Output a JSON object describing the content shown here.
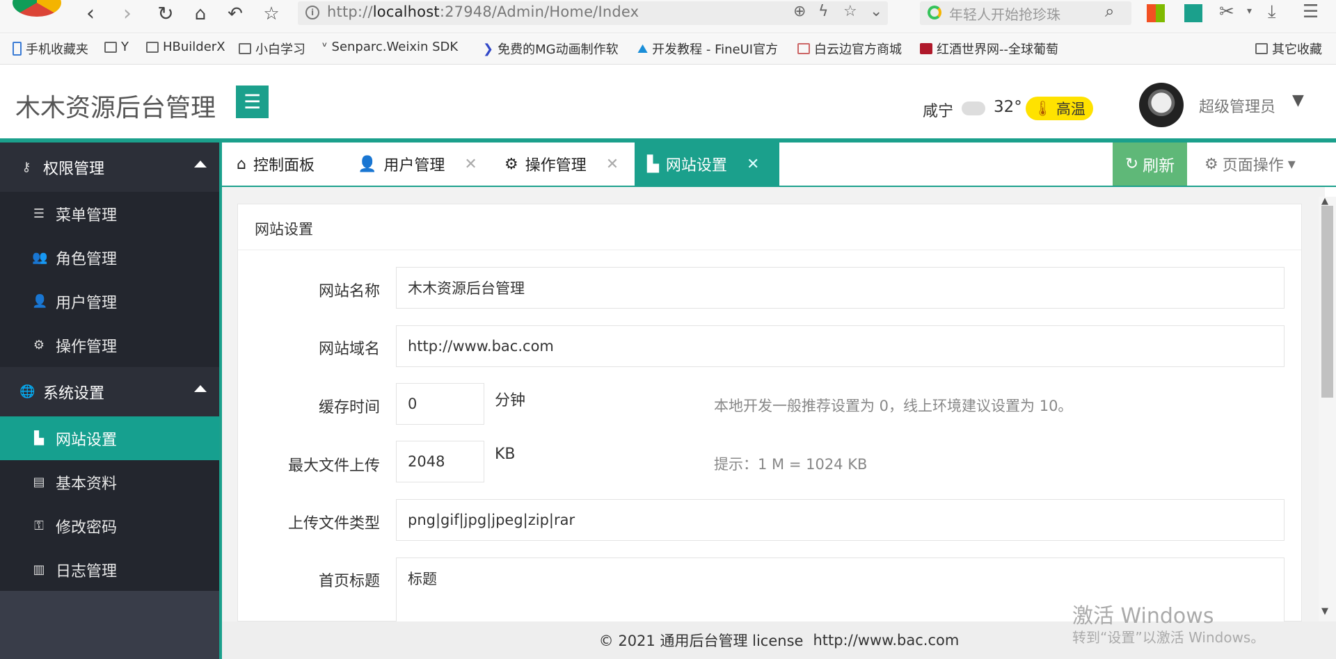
{
  "browser": {
    "url_prefix": "http://",
    "url_host": "localhost",
    "url_rest": ":27948/Admin/Home/Index",
    "search_placeholder": "年轻人开始抢珍珠"
  },
  "bookmarks": [
    "手机收藏夹",
    "Y",
    "HBuilderX",
    "小白学习",
    "Senparc.Weixin SDK",
    "免费的MG动画制作软",
    "开发教程 - FineUI官方",
    "白云边官方商城",
    "红酒世界网--全球葡萄",
    "其它收藏"
  ],
  "header": {
    "title": "木木资源后台管理",
    "city": "咸宁",
    "temperature": "32°",
    "weather_badge": "高温",
    "username": "超级管理员"
  },
  "sidebar": {
    "groups": [
      {
        "label": "权限管理",
        "items": [
          "菜单管理",
          "角色管理",
          "用户管理",
          "操作管理"
        ]
      },
      {
        "label": "系统设置",
        "items": [
          "网站设置",
          "基本资料",
          "修改密码",
          "日志管理"
        ]
      }
    ],
    "active_item": "网站设置"
  },
  "tabs": [
    {
      "label": "控制面板",
      "closable": false,
      "active": false
    },
    {
      "label": "用户管理",
      "closable": true,
      "active": false
    },
    {
      "label": "操作管理",
      "closable": true,
      "active": false
    },
    {
      "label": "网站设置",
      "closable": true,
      "active": true
    }
  ],
  "toolbar": {
    "refresh_label": "刷新",
    "page_ops_label": "页面操作"
  },
  "panel": {
    "title": "网站设置",
    "fields": {
      "site_name": {
        "label": "网站名称",
        "value": "木木资源后台管理"
      },
      "site_domain": {
        "label": "网站域名",
        "value": "http://www.bac.com"
      },
      "cache_time": {
        "label": "缓存时间",
        "value": "0",
        "unit": "分钟",
        "hint": "本地开发一般推荐设置为 0，线上环境建议设置为 10。"
      },
      "max_upload": {
        "label": "最大文件上传",
        "value": "2048",
        "unit": "KB",
        "hint": "提示：1 M = 1024 KB"
      },
      "upload_types": {
        "label": "上传文件类型",
        "value": "png|gif|jpg|jpeg|zip|rar"
      },
      "home_title": {
        "label": "首页标题",
        "value": "标题"
      }
    }
  },
  "footer": {
    "copyright": "© 2021 通用后台管理 license",
    "site": "http://www.bac.com"
  },
  "watermark": {
    "line1": "激活 Windows",
    "line2": "转到“设置”以激活 Windows。"
  },
  "colors": {
    "accent": "#1ba08c",
    "sidebar_bg": "#393d49",
    "refresh_green": "#5fb878",
    "badge_yellow": "#ffe200"
  }
}
